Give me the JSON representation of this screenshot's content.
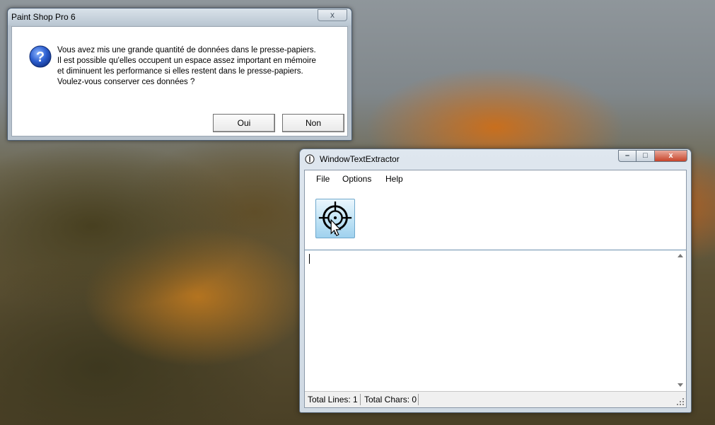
{
  "dialog": {
    "title": "Paint Shop Pro 6",
    "close_glyph": "x",
    "icon": "question-icon",
    "message_lines": [
      "Vous avez mis une grande quantité de données dans le presse-papiers.",
      "Il est possible qu'elles occupent un espace assez important en mémoire",
      "et diminuent les performance si elles restent dans le presse-papiers.",
      "Voulez-vous conserver ces données ?"
    ],
    "buttons": {
      "yes": "Oui",
      "no": "Non"
    }
  },
  "window": {
    "title": "WindowTextExtractor",
    "controls": {
      "minimize": "–",
      "maximize": "□",
      "close": "x"
    },
    "menu": [
      "File",
      "Options",
      "Help"
    ],
    "tool_icon": "crosshair-target-icon",
    "editor_text": "",
    "status": {
      "lines": "Total Lines: 1",
      "chars": "Total Chars: 0"
    }
  },
  "colors": {
    "dialog_frame": "#b7c2cd",
    "window_frame": "#cfd9e3",
    "close_red": "#c7442a",
    "tool_accent": "#9fd1ee"
  }
}
